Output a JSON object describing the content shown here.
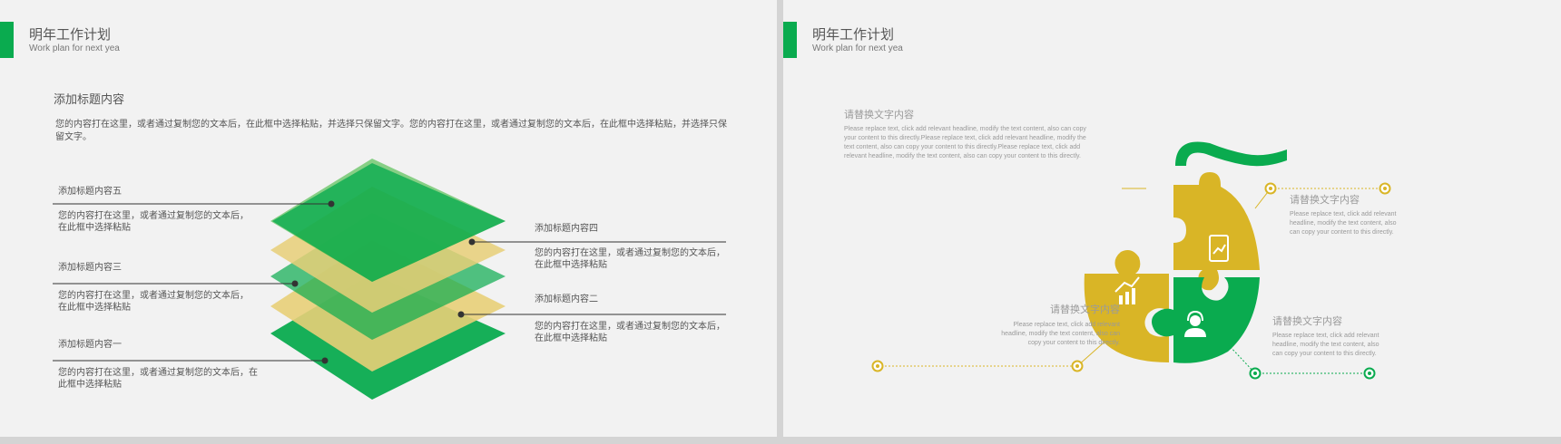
{
  "slide1": {
    "header": {
      "title": "明年工作计划",
      "subtitle": "Work plan for next yea"
    },
    "main": {
      "heading": "添加标题内容",
      "paragraph": "您的内容打在这里，或者通过复制您的文本后，在此框中选择粘贴，并选择只保留文字。您的内容打在这里，或者通过复制您的文本后，在此框中选择粘贴，并选择只保留文字。"
    },
    "items": [
      {
        "title": "添加标题内容五",
        "text": "您的内容打在这里，或者通过复制您的文本后，在此框中选择粘贴"
      },
      {
        "title": "添加标题内容四",
        "text": "您的内容打在这里，或者通过复制您的文本后，在此框中选择粘贴"
      },
      {
        "title": "添加标题内容三",
        "text": "您的内容打在这里，或者通过复制您的文本后，在此框中选择粘贴"
      },
      {
        "title": "添加标题内容二",
        "text": "您的内容打在这里，或者通过复制您的文本后，在此框中选择粘贴"
      },
      {
        "title": "添加标题内容一",
        "text": "您的内容打在这里，或者通过复制您的文本后，在此框中选择粘贴"
      }
    ]
  },
  "slide2": {
    "header": {
      "title": "明年工作计划",
      "subtitle": "Work plan for next yea"
    },
    "blocks": [
      {
        "title": "请替换文字内容",
        "text": "Please replace text, click add relevant headline, modify the text content, also can copy your content to this directly.Please replace text, click add relevant headline, modify the text content, also can copy your content to this directly.Please replace text, click add relevant headline, modify the text content, also can copy your content to this directly."
      },
      {
        "title": "请替换文字内容",
        "text": "Please replace text, click add relevant headline, modify the text content, also can copy your content to this directly."
      },
      {
        "title": "请替换文字内容",
        "text": "Please replace text, click add relevant headline, modify the text content, also can copy your content to this directly."
      },
      {
        "title": "请替换文字内容",
        "text": "Please replace text, click add relevant headline, modify the text content, also can copy your content to this directly."
      }
    ],
    "icons": [
      "tablet-chart-icon",
      "money-chart-icon",
      "support-agent-icon"
    ]
  },
  "colors": {
    "green": "#0aab4f",
    "yellow": "#d9b526",
    "light_yellow": "#ecd68b"
  }
}
